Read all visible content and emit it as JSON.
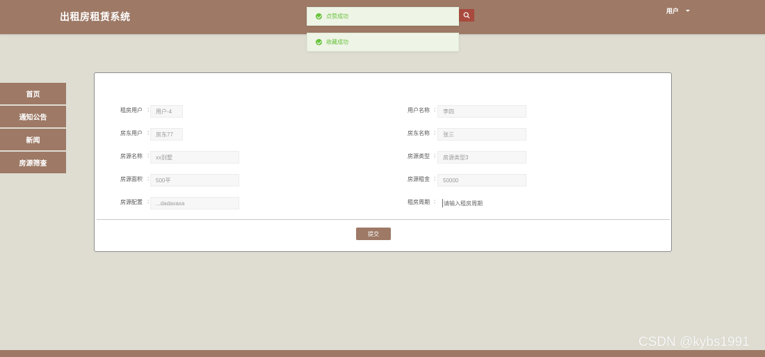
{
  "header": {
    "title": "出租房租赁系统",
    "user_label": "用户"
  },
  "toasts": [
    {
      "text": "点赞成功"
    },
    {
      "text": "收藏成功"
    }
  ],
  "sidebar": {
    "items": [
      {
        "label": "首页"
      },
      {
        "label": "通知公告"
      },
      {
        "label": "新闻"
      },
      {
        "label": "房源筛查"
      }
    ]
  },
  "form": {
    "rows": [
      {
        "left_label": "租房用户",
        "left_value": "用户-4",
        "right_label": "用户名称",
        "right_value": "李四"
      },
      {
        "left_label": "房东用户",
        "left_value": "房东77",
        "right_label": "房东名称",
        "right_value": "张三"
      },
      {
        "left_label": "房源名称",
        "left_value": "xx别墅",
        "right_label": "房源类型",
        "right_value": "房源类型3"
      },
      {
        "left_label": "房源面积",
        "left_value": "500平",
        "right_label": "房源租金",
        "right_value": "50000"
      },
      {
        "left_label": "房源配置",
        "left_value": "...dadaxaxa",
        "right_label": "租房周期",
        "right_placeholder": "请输入租房周期"
      }
    ],
    "submit_label": "提交"
  },
  "watermark": "CSDN @kybs1991",
  "colors": {
    "brand": "#9d7966",
    "background": "#dfddd2",
    "success": "#67c23a",
    "search_button": "#a94a3e"
  }
}
